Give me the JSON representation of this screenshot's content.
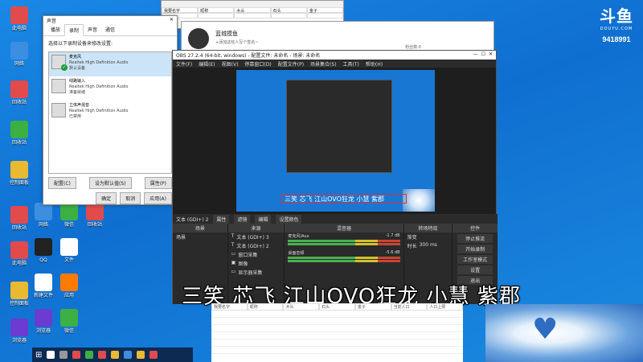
{
  "douyu": {
    "logo_text": "斗鱼",
    "domain": "DOUYU.COM",
    "room_id": "9418991"
  },
  "sound_dialog": {
    "title": "声音",
    "tabs": [
      "播放",
      "录制",
      "声音",
      "通信"
    ],
    "active_tab": 1,
    "description": "选择以下录制设备来修改设置:",
    "devices": [
      {
        "name": "麦克风",
        "driver": "Realtek High Definition Audio",
        "status": "默认设备",
        "selected": true
      },
      {
        "name": "线路输入",
        "driver": "Realtek High Definition Audio",
        "status": "准备就绪",
        "selected": false
      },
      {
        "name": "立体声混音",
        "driver": "Realtek High Definition Audio",
        "status": "已禁用",
        "selected": false
      }
    ],
    "configure_label": "配置(C)",
    "set_default_label": "设为默认值(S)",
    "properties_label": "属性(P)",
    "ok_label": "确定",
    "cancel_label": "取消",
    "apply_label": "应用(A)"
  },
  "profile": {
    "name": "蓝城摸鱼",
    "signature": "+添加这些人写个签名~",
    "followers": "粉丝数:0"
  },
  "obs": {
    "title": "OBS 27.2.4 (64-bit, windows) - 配置文件: 未命名 - 场景: 未命名",
    "menu": [
      "文件(F)",
      "编辑(E)",
      "视图(V)",
      "停靠窗口(D)",
      "配置文件(P)",
      "场景集合(S)",
      "工具(T)",
      "帮助(H)"
    ],
    "scene_bar": {
      "scene_name": "文本 (GDI+) 2",
      "properties": "属性",
      "filters": "滤镜",
      "edit": "编辑",
      "settings_label": "设置颜色"
    },
    "docks": {
      "scenes": {
        "header": "场景",
        "items": [
          "场景"
        ]
      },
      "sources": {
        "header": "来源",
        "items": [
          "文本 (GDI+) 3",
          "文本 (GDI+) 2",
          "窗口采集",
          "图像",
          "显示器采集"
        ]
      },
      "mixer": {
        "header": "混音器",
        "channels": [
          {
            "name": "麦克风/Aux",
            "db": "-1.7 dB"
          },
          {
            "name": "桌面音频",
            "db": "-5.6 dB"
          }
        ]
      },
      "transitions": {
        "header": "转场特效",
        "type": "渐变",
        "duration_label": "时长",
        "duration": "300 ms"
      },
      "controls": {
        "header": "控件",
        "buttons": [
          "停止推流",
          "开始录制",
          "工作室模式",
          "设置",
          "退出"
        ]
      }
    }
  },
  "overlay_text": "三笑 芯飞 江山OVO狂龙 小慧 紫郡",
  "subtitle_big": "三笑 芯飞 江山OVO狂龙 小慧 紫郡",
  "sheet": {
    "headers": [
      "我要名字",
      "昵称",
      "木头",
      "石头",
      "金子",
      "当前人口",
      "人口上限"
    ]
  },
  "desktop_icons": [
    {
      "label": "此电脑",
      "color": "#e14b4b"
    },
    {
      "label": "网络",
      "color": "#3c8ee0"
    },
    {
      "label": "回收站",
      "color": "#e14b4b"
    },
    {
      "label": "回收站",
      "color": "#3cb043"
    },
    {
      "label": "控制面板",
      "color": "#e8b931"
    },
    {
      "label": "QQ",
      "color": "#222"
    },
    {
      "label": "腾讯QQ",
      "color": "#1d77e3"
    },
    {
      "label": "文件",
      "color": "#ffffff"
    },
    {
      "label": "新建文件",
      "color": "#ffffff"
    },
    {
      "label": "应用",
      "color": "#ff7a00"
    },
    {
      "label": "浏览器",
      "color": "#6c3bd1"
    },
    {
      "label": "微信",
      "color": "#3cb043"
    }
  ]
}
